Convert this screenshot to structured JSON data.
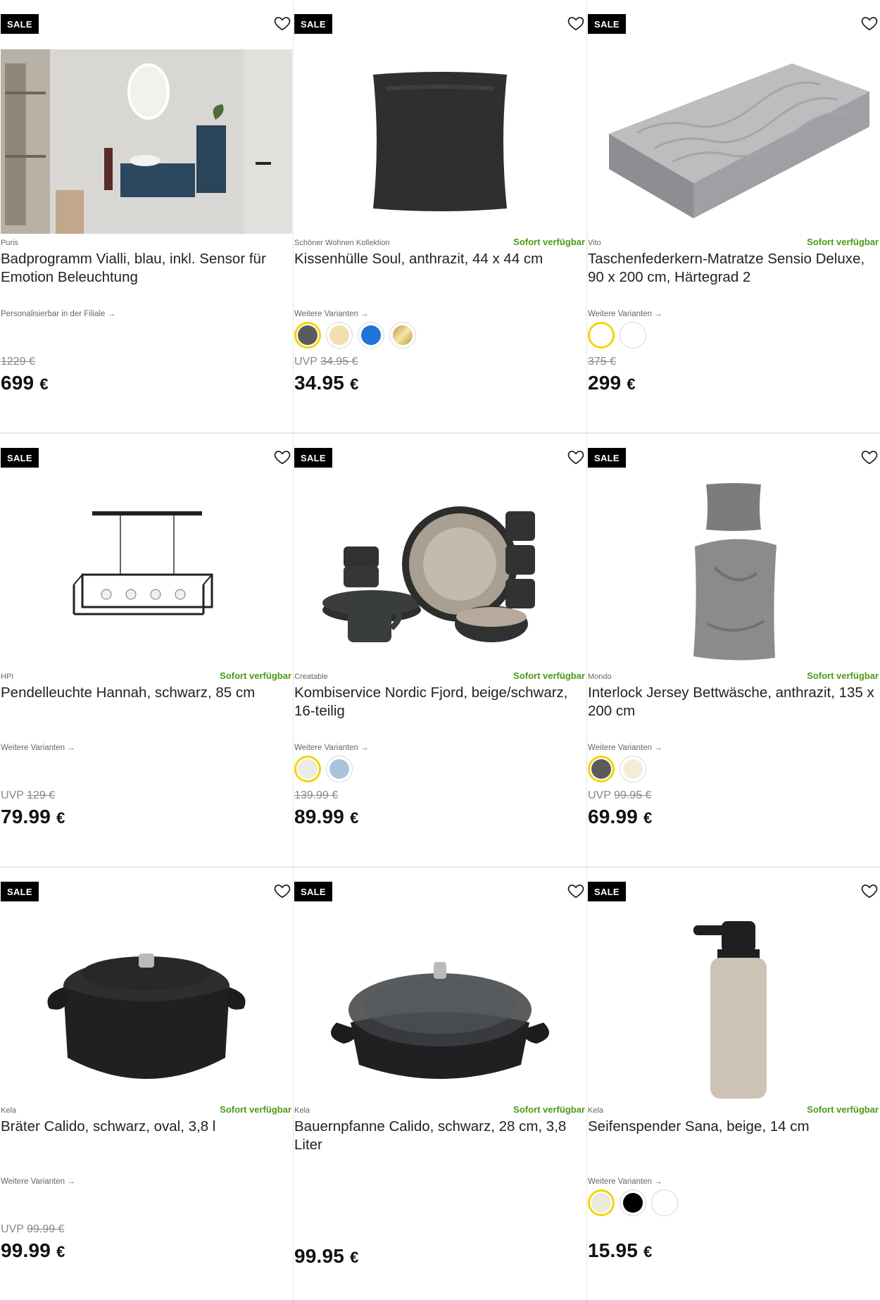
{
  "sale_label": "SALE",
  "more_variants_label": "Weitere Varianten →",
  "uvp_label": "UVP",
  "colors": {
    "availability": "#4c9a14",
    "selected_ring": "#f2d500"
  },
  "products": [
    {
      "brand": "Puris",
      "availability": "",
      "title": "Badprogramm Vialli, blau, inkl. Sensor für Emotion Beleuchtung",
      "subline": "Personalisierbar in der Filiale →",
      "swatches": [],
      "uvp": false,
      "old_price": "1229 €",
      "price": "699",
      "currency": "€",
      "image_icon": "bathroom-furniture-image"
    },
    {
      "brand": "Schöner Wohnen Kollektion",
      "availability": "Sofort verfügbar",
      "title": "Kissenhülle Soul, anthrazit, 44 x 44 cm",
      "subline": "Weitere Varianten →",
      "swatches": [
        "#5b5b5f",
        "#f1dfb0",
        "#1f74d6",
        "#d8bf6a"
      ],
      "uvp": true,
      "old_price": "34.95 €",
      "price": "34.95",
      "currency": "€",
      "image_icon": "cushion-image"
    },
    {
      "brand": "Vito",
      "availability": "Sofort verfügbar",
      "title": "Taschenfederkern-Matratze Sensio Deluxe, 90 x 200 cm, Härtegrad 2",
      "subline": "Weitere Varianten →",
      "swatches": [
        "#ffffff",
        "#ffffff"
      ],
      "uvp": false,
      "old_price": "375 €",
      "price": "299",
      "currency": "€",
      "image_icon": "mattress-image"
    },
    {
      "brand": "HPI",
      "availability": "Sofort verfügbar",
      "title": "Pendelleuchte Hannah, schwarz, 85 cm",
      "subline": "Weitere Varianten →",
      "swatches": [],
      "uvp": true,
      "old_price": "129 €",
      "price": "79.99",
      "currency": "€",
      "image_icon": "pendant-lamp-image"
    },
    {
      "brand": "Creatable",
      "availability": "Sofort verfügbar",
      "title": "Kombiservice Nordic Fjord, beige/schwarz, 16-teilig",
      "subline": "Weitere Varianten →",
      "swatches": [
        "#ecebe4",
        "#a9c3dd"
      ],
      "uvp": false,
      "old_price": "139.99 €",
      "price": "89.99",
      "currency": "€",
      "image_icon": "tableware-set-image"
    },
    {
      "brand": "Mondo",
      "availability": "Sofort verfügbar",
      "title": "Interlock Jersey Bettwäsche, anthrazit, 135 x 200 cm",
      "subline": "Weitere Varianten →",
      "swatches": [
        "#5a5a5c",
        "#f4ecd6"
      ],
      "uvp": true,
      "old_price": "99.95 €",
      "price": "69.99",
      "currency": "€",
      "image_icon": "bed-linen-image"
    },
    {
      "brand": "Kela",
      "availability": "Sofort verfügbar",
      "title": "Bräter Calido, schwarz, oval, 3,8 l",
      "subline": "Weitere Varianten →",
      "swatches": [],
      "uvp": true,
      "old_price": "99.99 €",
      "price": "99.99",
      "currency": "€",
      "image_icon": "roaster-pot-image"
    },
    {
      "brand": "Kela",
      "availability": "Sofort verfügbar",
      "title": "Bauernpfanne Calido, schwarz, 28 cm, 3,8 Liter",
      "subline": "",
      "swatches": [],
      "uvp": false,
      "old_price": "",
      "price": "99.95",
      "currency": "€",
      "image_icon": "farmer-pan-image"
    },
    {
      "brand": "Kela",
      "availability": "Sofort verfügbar",
      "title": "Seifenspender Sana, beige, 14 cm",
      "subline": "Weitere Varianten →",
      "swatches": [
        "#ece8dc",
        "#000000",
        "#ffffff"
      ],
      "uvp": false,
      "old_price": "",
      "price": "15.95",
      "currency": "€",
      "image_icon": "soap-dispenser-image"
    }
  ]
}
